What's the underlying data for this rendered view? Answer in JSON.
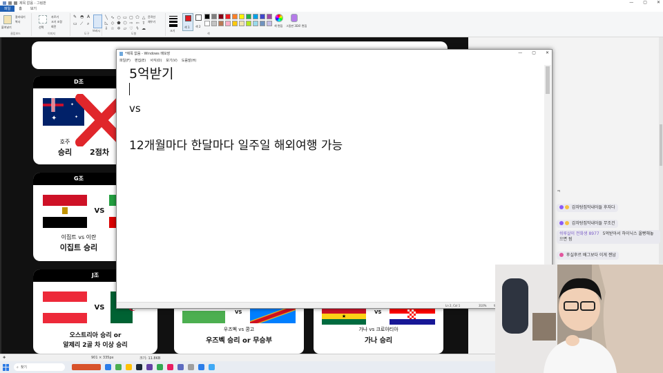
{
  "paint": {
    "title": "제목 없음 - 그림판",
    "tabs": [
      "파일",
      "홈",
      "보기"
    ],
    "groups": [
      "클립보드",
      "이미지",
      "도구",
      "도형",
      "색"
    ],
    "clipboard": {
      "paste": "붙여넣기",
      "cut": "잘라내기",
      "copy": "복사"
    },
    "image": {
      "select": "선택",
      "crop": "자르기",
      "resize": "크기 조정",
      "rotate": "회전"
    },
    "shapes": {
      "outline": "윤곽선",
      "fill": "채우기"
    },
    "brush": "브러시",
    "size": "크기",
    "color1": "색 1",
    "color2": "색 2",
    "edit_colors": "색 편집",
    "paint3d": "그림판 3D로 편집",
    "palette": [
      "#000000",
      "#7f7f7f",
      "#880015",
      "#ed1c24",
      "#ff7f27",
      "#fff200",
      "#22b14c",
      "#00a2e8",
      "#3f48cc",
      "#a349a4",
      "#ffffff",
      "#c3c3c3",
      "#b97a57",
      "#ffaec9",
      "#ffc90e",
      "#efe4b0",
      "#b5e61d",
      "#99d9ea",
      "#7092be",
      "#c8bfe7"
    ],
    "status": {
      "position": "901 × 335px",
      "size": "크기: 11.8KB"
    }
  },
  "poster": {
    "groups": [
      {
        "label": "D조",
        "team": "호주",
        "result": "승리",
        "extra": "2점차"
      },
      {
        "label": "G조",
        "match": "이집트 vs 이란",
        "result": "이집트 승리"
      },
      {
        "label": "J조",
        "line1": "오스트리아 승리 or",
        "line2": "알제리 2골 차 이상 승리"
      }
    ],
    "bottom": [
      {
        "match": "우즈벡 vs 콩고",
        "result": "우즈벡 승리 or 무승부"
      },
      {
        "match": "가나 vs 크로아티아",
        "result": "가나 승리"
      }
    ],
    "vs": "VS"
  },
  "notepad": {
    "title": "*제목 없음 - Windows 메모장",
    "menu": [
      "파일(F)",
      "편집(E)",
      "서식(O)",
      "보기(V)",
      "도움말(H)"
    ],
    "lines": [
      "5억받기",
      "vs",
      "12개월마다 한달마다 일주일 해외여행 가능"
    ],
    "status": {
      "position": "Ln 2, Col 1",
      "zoom": "310%",
      "eol": "Windows (CRLF)",
      "encoding": "UTF-8"
    }
  },
  "chat": {
    "messages": [
      {
        "nick": "",
        "text": "감자탕집막내아들 후자다"
      },
      {
        "nick": "",
        "text": "감자탕집막내아들 무조건"
      },
      {
        "nick": "쉬루살이 전화생 8977",
        "text": "5억받아서 하이닉스 올빵해놓으면 됨"
      },
      {
        "nick": "",
        "text": "후실후르 배그보다 이게 젠남"
      }
    ]
  },
  "taskbar": {
    "search_placeholder": "찾기"
  }
}
